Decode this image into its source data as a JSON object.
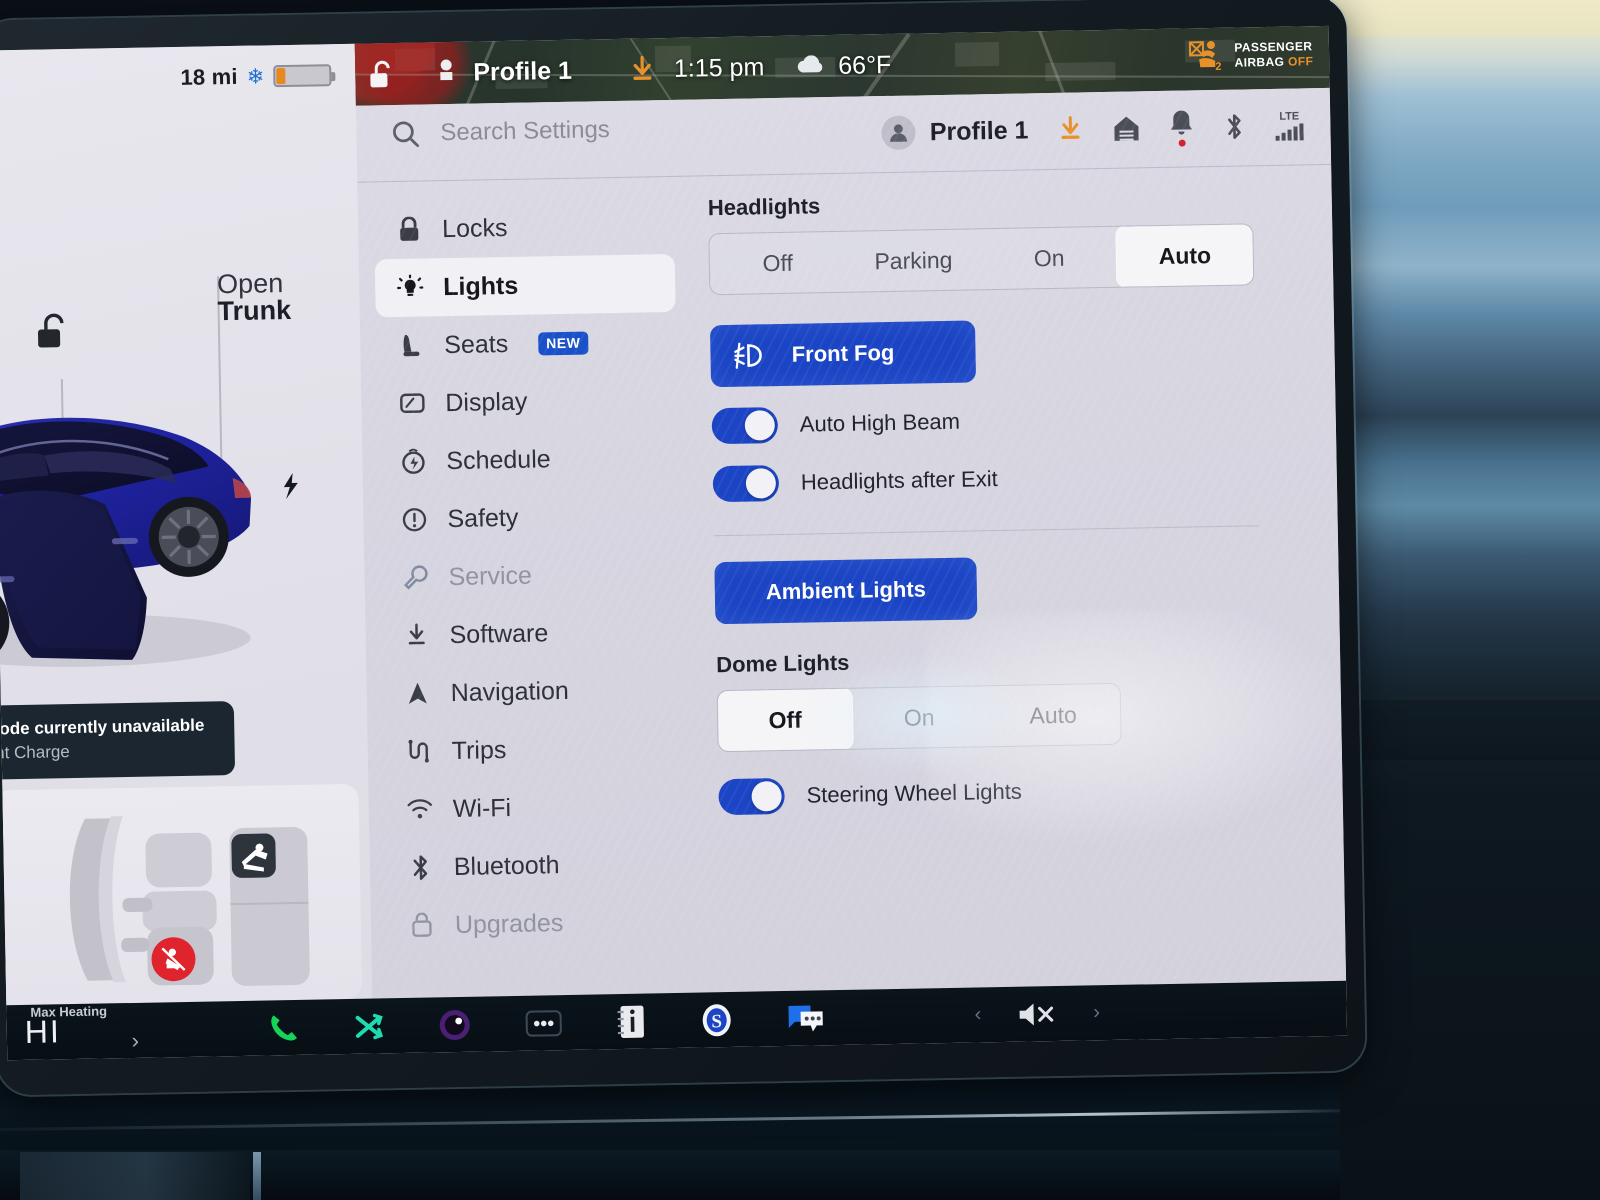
{
  "car_panel": {
    "range": "18 mi",
    "snowflake_icon": "snowflake-icon",
    "battery_icon": "battery-icon",
    "trunk_label": "Open\nTrunk",
    "trunk_label_line1": "Open",
    "trunk_label_line2": "Trunk",
    "unlock_icon": "unlock-icon",
    "charge_port_icon": "charge-bolt-icon",
    "tooltip": {
      "line1": "Mode currently unavailable",
      "line2": "ent Charge"
    },
    "seat_diagram": {
      "child_seat_icon": "child-seat-icon",
      "seatbelt_warning_icon": "seatbelt-warning-icon"
    }
  },
  "map_header": {
    "unlock_icon": "unlock-icon",
    "pedestrian_icon": "pedestrian-icon",
    "profile": "Profile 1",
    "download_icon": "download-icon",
    "time": "1:15 pm",
    "weather_icon": "cloud-icon",
    "temperature": "66°F",
    "airbag_icon": "passenger-airbag-icon",
    "airbag_line1": "PASSENGER",
    "airbag_line2": "AIRBAG",
    "airbag_state": "OFF"
  },
  "settings_header": {
    "search_icon": "search-icon",
    "search_placeholder": "Search Settings",
    "search_value": "",
    "profile_icon": "person-icon",
    "profile_name": "Profile 1",
    "download_icon": "download-icon",
    "garage_icon": "garage-icon",
    "bell_icon": "bell-icon",
    "bluetooth_icon": "bluetooth-icon",
    "lte_label": "LTE",
    "signal_icon": "signal-bars-icon"
  },
  "sidebar": {
    "items": [
      {
        "label": "Locks",
        "icon": "lock-icon",
        "state": "default"
      },
      {
        "label": "Lights",
        "icon": "sun-lights-icon",
        "state": "active"
      },
      {
        "label": "Seats",
        "icon": "seat-icon",
        "state": "default",
        "badge": "NEW"
      },
      {
        "label": "Display",
        "icon": "display-icon",
        "state": "default"
      },
      {
        "label": "Schedule",
        "icon": "clock-bolt-icon",
        "state": "default"
      },
      {
        "label": "Safety",
        "icon": "alert-circle-icon",
        "state": "default"
      },
      {
        "label": "Service",
        "icon": "wrench-icon",
        "state": "muted"
      },
      {
        "label": "Software",
        "icon": "download-icon",
        "state": "default"
      },
      {
        "label": "Navigation",
        "icon": "navigation-arrow-icon",
        "state": "default"
      },
      {
        "label": "Trips",
        "icon": "trips-icon",
        "state": "default"
      },
      {
        "label": "Wi-Fi",
        "icon": "wifi-icon",
        "state": "default"
      },
      {
        "label": "Bluetooth",
        "icon": "bluetooth-icon",
        "state": "default"
      },
      {
        "label": "Upgrades",
        "icon": "bag-icon",
        "state": "muted"
      }
    ]
  },
  "content": {
    "headlights": {
      "title": "Headlights",
      "options": [
        "Off",
        "Parking",
        "On",
        "Auto"
      ],
      "selected": "Auto"
    },
    "front_fog": {
      "label": "Front Fog",
      "icon": "fog-light-icon",
      "active": true
    },
    "auto_high_beam": {
      "label": "Auto High Beam",
      "on": true
    },
    "headlights_after_exit": {
      "label": "Headlights after Exit",
      "on": true
    },
    "ambient_lights": {
      "label": "Ambient Lights",
      "active": true
    },
    "dome_lights": {
      "title": "Dome Lights",
      "options": [
        "Off",
        "On",
        "Auto"
      ],
      "selected": "Off"
    },
    "steering_wheel_lights": {
      "label": "Steering Wheel Lights",
      "on": true
    }
  },
  "taskbar": {
    "max_heating_label": "Max Heating",
    "temperature": "HI",
    "chevron_icon": "chevron-right-icon",
    "apps": [
      {
        "name": "phone-icon"
      },
      {
        "name": "shuffle-icon"
      },
      {
        "name": "camera-icon"
      },
      {
        "name": "more-dots-icon"
      },
      {
        "name": "release-notes-icon"
      },
      {
        "name": "slacker-icon"
      },
      {
        "name": "messages-icon"
      }
    ],
    "volume_prev_icon": "chevron-left-icon",
    "volume_mute_icon": "volume-mute-icon",
    "volume_next_icon": "chevron-right-icon"
  },
  "colors": {
    "accent_blue": "#1b45c4",
    "badge_blue": "#1a51c9",
    "warning_orange": "#e8912a",
    "alert_red": "#e0242e",
    "panel_bg": "#d7d5e0"
  }
}
